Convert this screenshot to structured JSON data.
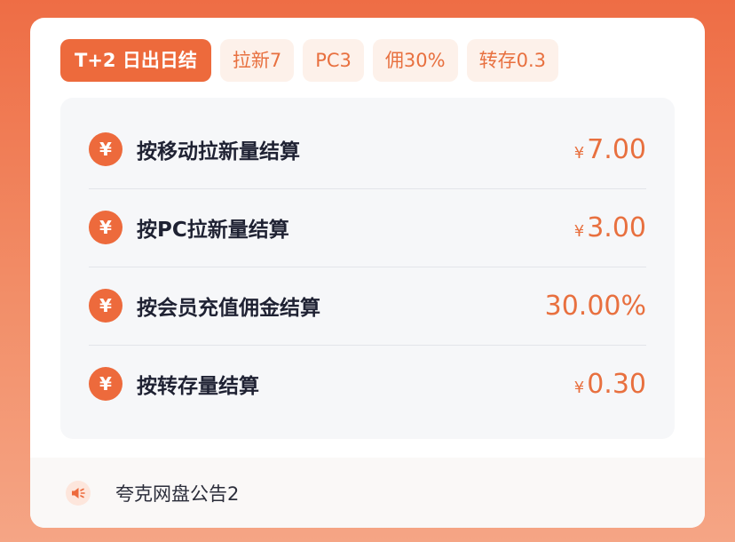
{
  "tags": [
    {
      "label": "T+2 日出日结",
      "active": true
    },
    {
      "label": "拉新7",
      "active": false
    },
    {
      "label": "PC3",
      "active": false
    },
    {
      "label": "佣30%",
      "active": false
    },
    {
      "label": "转存0.3",
      "active": false
    }
  ],
  "settlement": {
    "icon_glyph": "¥",
    "rows": [
      {
        "label": "按移动拉新量结算",
        "currency": "¥",
        "value": "7.00"
      },
      {
        "label": "按PC拉新量结算",
        "currency": "¥",
        "value": "3.00"
      },
      {
        "label": "按会员充值佣金结算",
        "currency": "",
        "value": "30.00%"
      },
      {
        "label": "按转存量结算",
        "currency": "¥",
        "value": "0.30"
      }
    ]
  },
  "notice": {
    "icon": "speaker-icon",
    "text": "夸克网盘公告2"
  },
  "colors": {
    "accent": "#ed6a3c",
    "tag_bg": "#fdf1ea",
    "label_text": "#1f2233"
  }
}
